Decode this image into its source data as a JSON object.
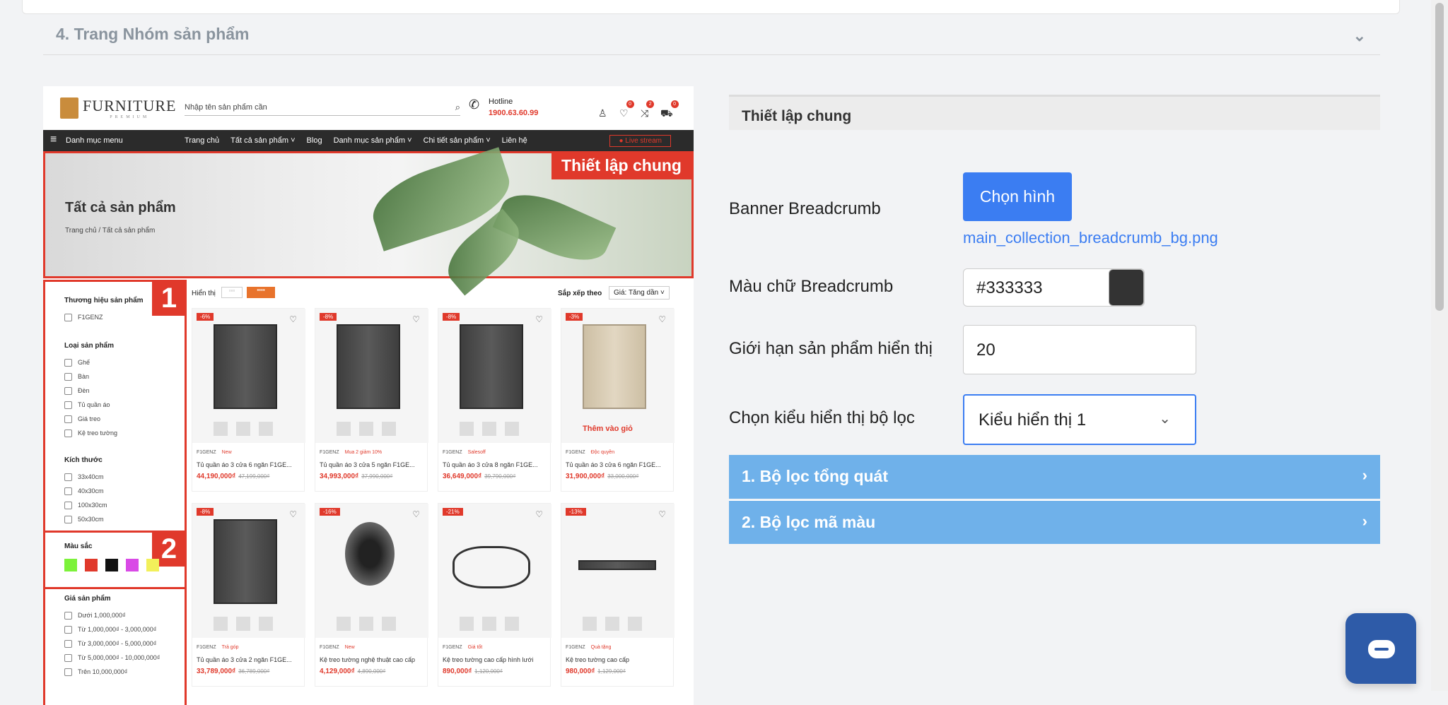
{
  "section": {
    "title": "4. Trang Nhóm sản phẩm"
  },
  "preview": {
    "logo": "FURNITURE",
    "logo_sub": "PREMIUM",
    "search_placeholder": "Nhập tên sản phẩm cần",
    "hotline_label": "Hotline",
    "hotline_number": "1900.63.60.99",
    "icon_badges": [
      "0",
      "2",
      "0"
    ],
    "nav": {
      "menu": "Danh mục menu",
      "links": [
        "Trang chủ",
        "Tất cả sản phẩm ˅",
        "Blog",
        "Danh mục sản phẩm ˅",
        "Chi tiết sản phẩm ˅",
        "Liên hệ"
      ],
      "live": "● Live stream"
    },
    "banner": {
      "title": "Tất cả sản phẩm",
      "breadcrumb": "Trang chủ  /  Tất cả sản phẩm",
      "tag": "Thiết lập chung"
    },
    "sidebar": {
      "box1_num": "1",
      "box2_num": "2",
      "brand_title": "Thương hiệu sản phẩm",
      "brands": [
        "F1GENZ"
      ],
      "type_title": "Loại sản phẩm",
      "types": [
        "Ghế",
        "Bàn",
        "Đèn",
        "Tủ quần áo",
        "Giá treo",
        "Kệ treo tường"
      ],
      "size_title": "Kích thước",
      "sizes": [
        "33x40cm",
        "40x30cm",
        "100x30cm",
        "50x30cm"
      ],
      "color_title": "Màu sắc",
      "colors": [
        "#7cf23a",
        "#e0392b",
        "#111111",
        "#d94ae6",
        "#f2f05a"
      ],
      "price_title": "Giá sản phẩm",
      "prices": [
        "Dưới 1,000,000₫",
        "Từ 1,000,000₫ - 3,000,000₫",
        "Từ 3,000,000₫ - 5,000,000₫",
        "Từ 5,000,000₫ - 10,000,000₫",
        "Trên 10,000,000₫"
      ]
    },
    "toolbar": {
      "show_label": "Hiển thị",
      "sort_label": "Sắp xếp theo",
      "sort_value": "Giá: Tăng dần ˅"
    },
    "products": [
      {
        "discount": "-6%",
        "brand": "F1GENZ",
        "tag": "New",
        "name": "Tủ quần áo 3 cửa 6 ngăn F1GE...",
        "price": "44,190,000₫",
        "old": "47,199,000₫",
        "kind": "dark"
      },
      {
        "discount": "-8%",
        "brand": "F1GENZ",
        "tag": "Mua 2 giảm 10%",
        "name": "Tủ quần áo 3 cửa 5 ngăn F1GE...",
        "price": "34,993,000₫",
        "old": "37,990,000₫",
        "kind": "dark"
      },
      {
        "discount": "-8%",
        "brand": "F1GENZ",
        "tag": "Salesoff",
        "name": "Tủ quần áo 3 cửa 8 ngăn F1GE...",
        "price": "36,649,000₫",
        "old": "39,790,000₫",
        "kind": "dark"
      },
      {
        "discount": "-3%",
        "brand": "F1GENZ",
        "tag": "Độc quyền",
        "name": "Tủ quần áo 3 cửa 6 ngăn F1GE...",
        "price": "31,900,000₫",
        "old": "33,000,000₫",
        "kind": "light",
        "add_to_cart": "Thêm vào giỏ"
      },
      {
        "discount": "-8%",
        "brand": "F1GENZ",
        "tag": "Trả góp",
        "name": "Tủ quần áo 3 cửa 2 ngăn F1GE...",
        "price": "33,789,000₫",
        "old": "36,789,000₫",
        "kind": "dark"
      },
      {
        "discount": "-16%",
        "brand": "F1GENZ",
        "tag": "New",
        "name": "Kệ treo tường nghệ thuật cao cấp",
        "price": "4,129,000₫",
        "old": "4,890,000₫",
        "kind": "disc"
      },
      {
        "discount": "-21%",
        "brand": "F1GENZ",
        "tag": "Giá tốt",
        "name": "Kệ treo tường cao cấp hình lưới",
        "price": "890,000₫",
        "old": "1,120,000₫",
        "kind": "shelf"
      },
      {
        "discount": "-13%",
        "brand": "F1GENZ",
        "tag": "Quà tặng",
        "name": "Kệ treo tường cao cấp",
        "price": "980,000₫",
        "old": "1,129,000₫",
        "kind": "bar"
      }
    ]
  },
  "settings": {
    "header": "Thiết lập chung",
    "banner_label": "Banner Breadcrumb",
    "choose_button": "Chọn hình",
    "file_name": "main_collection_breadcrumb_bg.png",
    "color_label": "Màu chữ Breadcrumb",
    "color_value": "#333333",
    "limit_label": "Giới hạn sản phẩm hiển thị",
    "limit_value": "20",
    "filter_style_label": "Chọn kiểu hiển thị bộ lọc",
    "filter_style_value": "Kiểu hiển thị 1",
    "accordions": [
      "1. Bộ lọc tổng quát",
      "2. Bộ lọc mã màu"
    ]
  }
}
